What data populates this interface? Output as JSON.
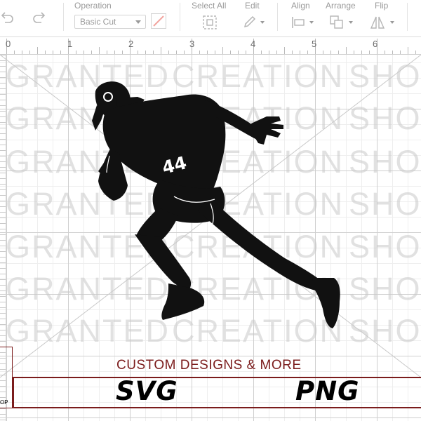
{
  "toolbar": {
    "operation_label": "Operation",
    "operation_value": "Basic Cut",
    "select_all_label": "Select All",
    "edit_label": "Edit",
    "align_label": "Align",
    "arrange_label": "Arrange",
    "flip_label": "Flip"
  },
  "ruler": {
    "marks": [
      "0",
      "1",
      "2",
      "3",
      "4",
      "5",
      "6"
    ]
  },
  "watermark": {
    "words": [
      "GRANTED",
      "CREATION",
      "SHOP"
    ]
  },
  "design": {
    "jersey_number": "44",
    "banner_title": "CUSTOM DESIGNS & MORE",
    "format_svg": "SVG",
    "format_png": "PNG",
    "side_fragment": "OP"
  },
  "colors": {
    "banner_accent": "#7b1c1c",
    "silhouette": "#111111",
    "watermark": "#c8c8c8"
  }
}
